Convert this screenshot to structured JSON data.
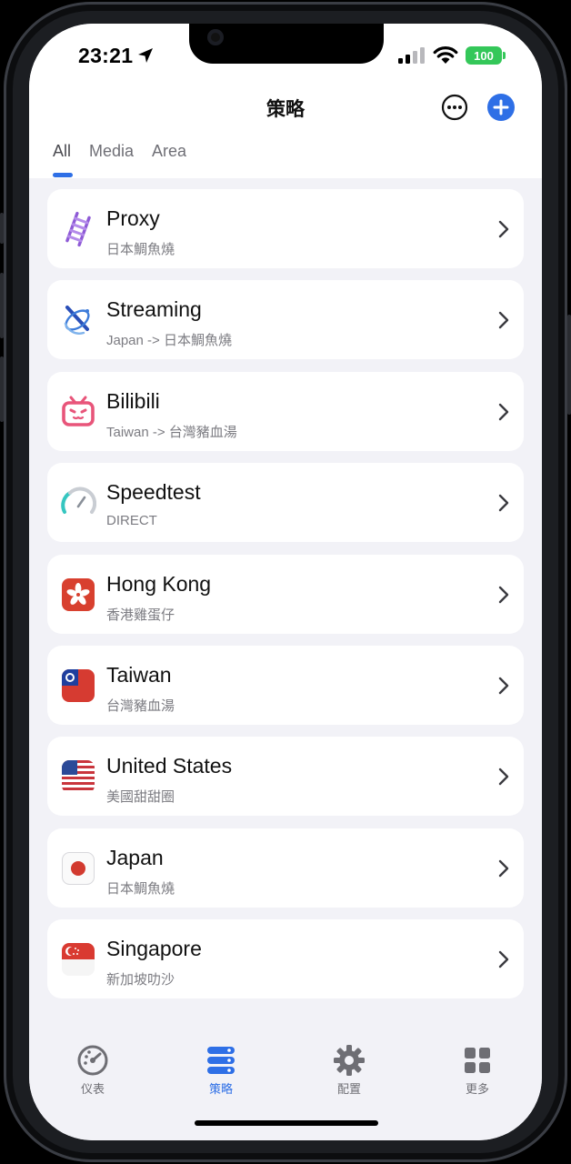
{
  "status": {
    "time": "23:21",
    "battery": "100"
  },
  "nav": {
    "title": "策略",
    "tabs": [
      {
        "label": "All",
        "active": true
      },
      {
        "label": "Media",
        "active": false
      },
      {
        "label": "Area",
        "active": false
      }
    ]
  },
  "policies": [
    {
      "name": "Proxy",
      "detail": "日本鯛魚燒",
      "icon": "ladder-icon"
    },
    {
      "name": "Streaming",
      "detail": "Japan -> 日本鯛魚燒",
      "icon": "satellite-icon"
    },
    {
      "name": "Bilibili",
      "detail": "Taiwan -> 台灣豬血湯",
      "icon": "bilibili-tv-icon"
    },
    {
      "name": "Speedtest",
      "detail": "DIRECT",
      "icon": "speedometer-icon"
    },
    {
      "name": "Hong Kong",
      "detail": "香港雞蛋仔",
      "icon": "hong-kong-flag-icon"
    },
    {
      "name": "Taiwan",
      "detail": "台灣豬血湯",
      "icon": "taiwan-flag-icon"
    },
    {
      "name": "United States",
      "detail": "美國甜甜圈",
      "icon": "us-flag-icon"
    },
    {
      "name": "Japan",
      "detail": "日本鯛魚燒",
      "icon": "japan-flag-icon"
    },
    {
      "name": "Singapore",
      "detail": "新加坡叻沙",
      "icon": "singapore-flag-icon"
    }
  ],
  "tabbar": [
    {
      "label": "仪表",
      "icon": "dashboard-icon",
      "active": false
    },
    {
      "label": "策略",
      "icon": "policy-servers-icon",
      "active": true
    },
    {
      "label": "配置",
      "icon": "gear-icon",
      "active": false
    },
    {
      "label": "更多",
      "icon": "grid-icon",
      "active": false
    }
  ],
  "colors": {
    "accent": "#2e6fe6",
    "background": "#f2f2f7",
    "card": "#ffffff"
  }
}
